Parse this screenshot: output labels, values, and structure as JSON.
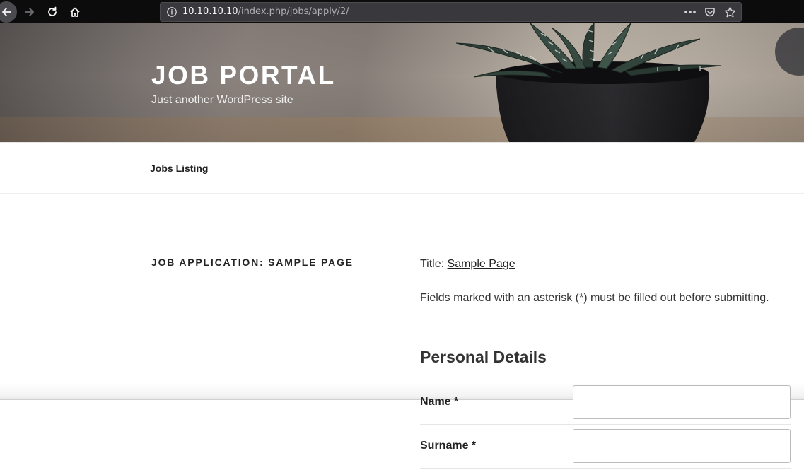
{
  "browser": {
    "url_host": "10.10.10.10",
    "url_path": "/index.php/jobs/apply/2/",
    "icons": [
      "back-arrow-icon",
      "forward-arrow-icon",
      "reload-icon",
      "home-icon",
      "info-icon",
      "page-actions-icon",
      "pocket-icon",
      "bookmark-star-icon"
    ]
  },
  "site": {
    "title": "JOB PORTAL",
    "description": "Just another WordPress site"
  },
  "nav": {
    "items": [
      {
        "label": "Jobs Listing"
      }
    ]
  },
  "content": {
    "page_title": "JOB APPLICATION: SAMPLE PAGE",
    "job_title_prefix": "Title:",
    "job_title_link": "Sample Page",
    "required_notice": "Fields marked with an asterisk (*) must be filled out before submitting.",
    "section_heading": "Personal Details",
    "fields": [
      {
        "label": "Name *",
        "value": ""
      },
      {
        "label": "Surname *",
        "value": ""
      }
    ]
  }
}
